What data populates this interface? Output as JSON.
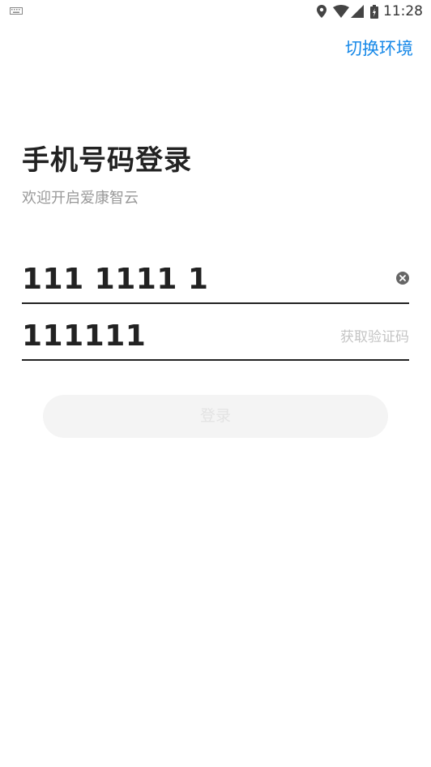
{
  "status_bar": {
    "time": "11:28",
    "icons": [
      "keyboard-icon",
      "location-icon",
      "wifi-icon",
      "signal-icon",
      "battery-icon"
    ]
  },
  "header": {
    "switch_env_label": "切换环境"
  },
  "login": {
    "title": "手机号码登录",
    "subtitle": "欢迎开启爱康智云",
    "phone_value": "111 1111 1",
    "code_value": "111111",
    "get_code_label": "获取验证码",
    "submit_label": "登录"
  },
  "colors": {
    "accent": "#1688e8",
    "text_primary": "#222222",
    "text_secondary": "#999999",
    "placeholder": "#c4c4c4",
    "button_bg": "#f4f4f4",
    "button_text": "#e3e3e3"
  }
}
